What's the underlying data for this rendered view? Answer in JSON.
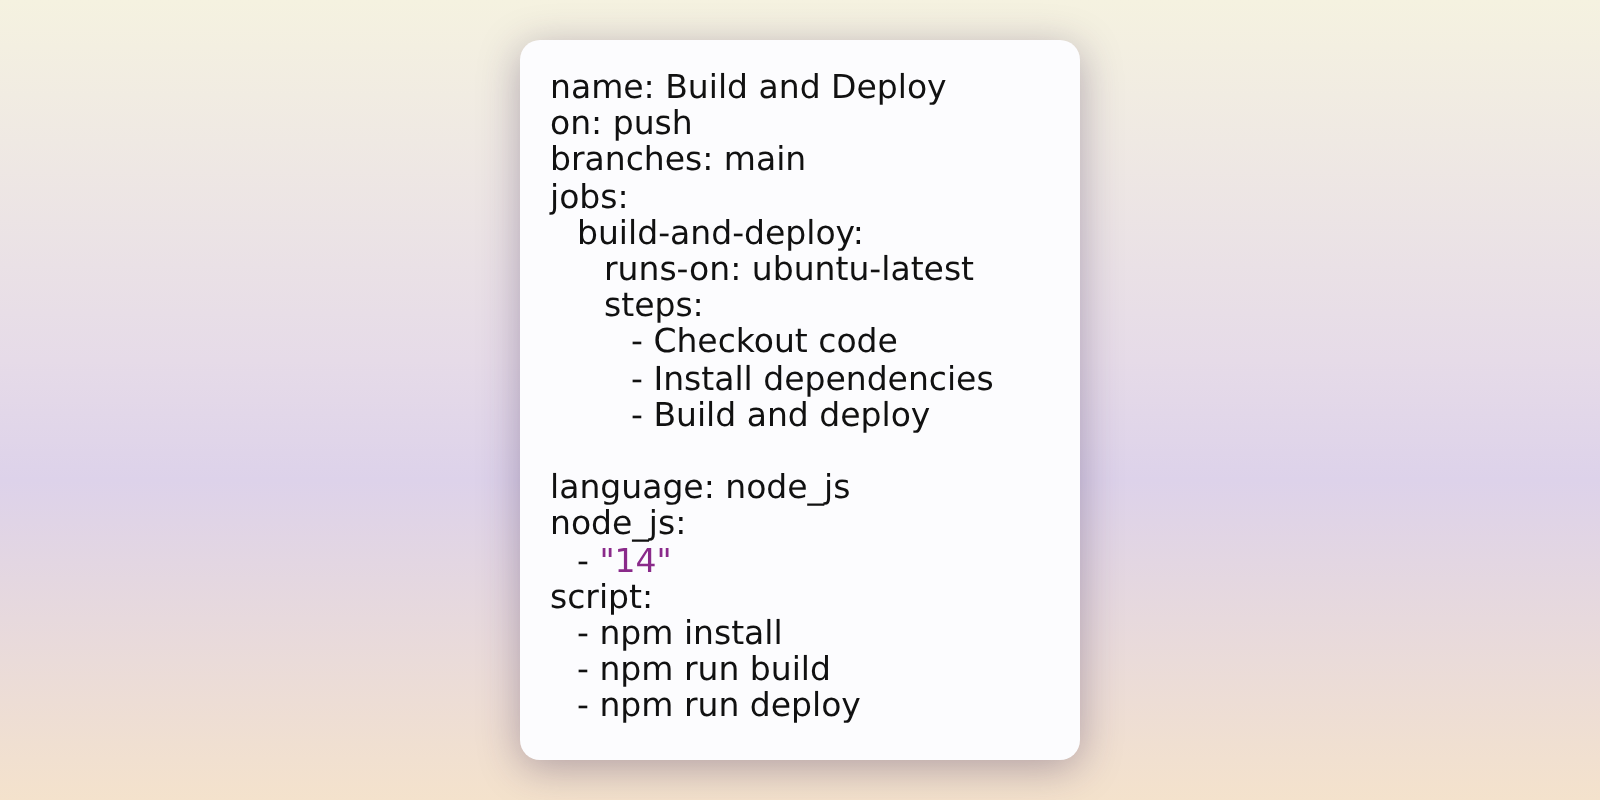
{
  "blocks": [
    {
      "lines": [
        {
          "text": "name: Build and Deploy"
        },
        {
          "text": "on: push"
        },
        {
          "text": "branches: main"
        },
        {
          "text": "jobs:",
          "children": [
            {
              "text": "build-and-deploy:",
              "children": [
                {
                  "text": "runs-on: ubuntu-latest"
                },
                {
                  "text": "steps:",
                  "children": [
                    {
                      "text": "- Checkout code"
                    },
                    {
                      "text": "- Install dependencies"
                    },
                    {
                      "text": "- Build and deploy"
                    }
                  ]
                }
              ]
            }
          ]
        }
      ]
    },
    {
      "lines": [
        {
          "text": "language: node_js"
        },
        {
          "text": "node_js:",
          "children": [
            {
              "text": "- ",
              "string": "\"14\""
            }
          ]
        },
        {
          "text": "script:",
          "children": [
            {
              "text": "- npm install"
            },
            {
              "text": "- npm run build"
            },
            {
              "text": "- npm run deploy"
            }
          ]
        }
      ]
    }
  ]
}
